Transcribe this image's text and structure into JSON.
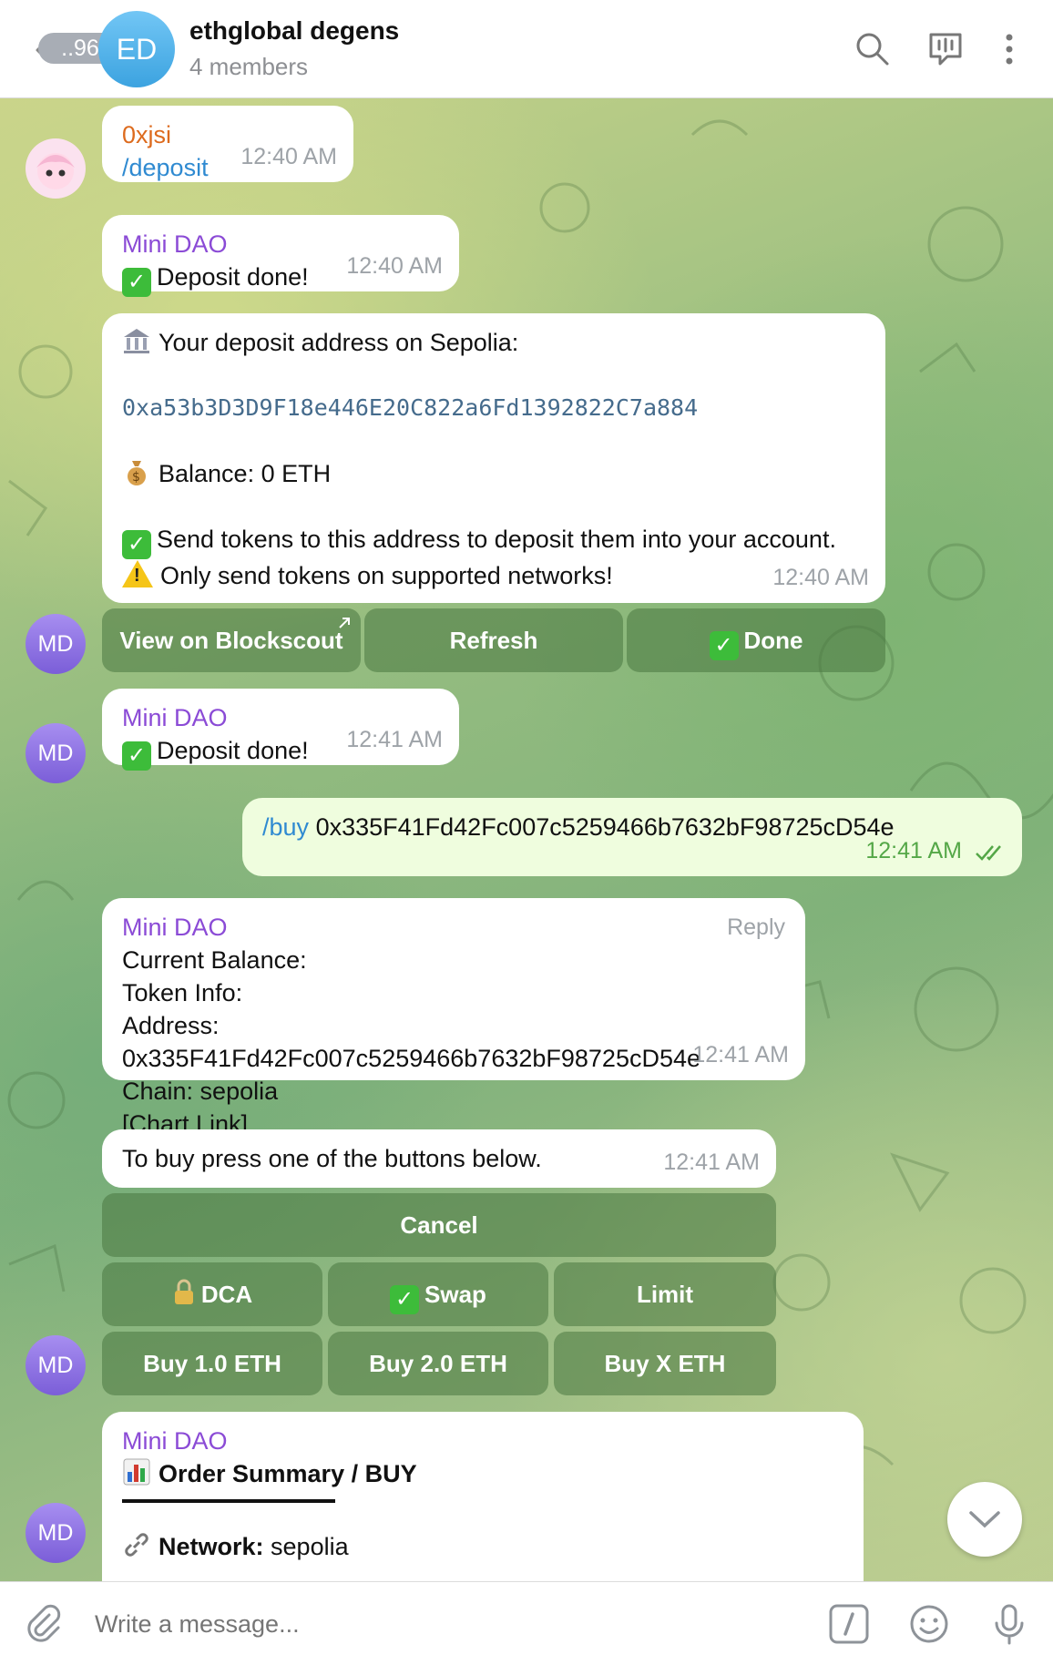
{
  "header": {
    "unread_count": "..96",
    "avatar_initials": "ED",
    "title": "ethglobal degens",
    "subtitle": "4 members"
  },
  "messages": {
    "m1": {
      "sender": "0xjsi",
      "command": "/deposit",
      "time": "12:40 AM"
    },
    "m2": {
      "sender": "Mini DAO",
      "text": "Deposit done!",
      "time": "12:40 AM"
    },
    "m3": {
      "line1": "Your deposit address on Sepolia:",
      "address": "0xa53b3D3D9F18e446E20C822a6Fd1392822C7a884",
      "balance": "Balance: 0 ETH",
      "send": "Send tokens to this address to deposit them into your account.",
      "warn": "Only send tokens on supported networks!",
      "time": "12:40 AM",
      "buttons": {
        "view": "View on Blockscout",
        "refresh": "Refresh",
        "done": "Done"
      }
    },
    "m4": {
      "sender": "Mini DAO",
      "text": "Deposit done!",
      "time": "12:41 AM"
    },
    "m5": {
      "command": "/buy",
      "text": "0x335F41Fd42Fc007c5259466b7632bF98725cD54e",
      "time": "12:41 AM"
    },
    "m6": {
      "sender": "Mini DAO",
      "reply": "Reply",
      "lines": [
        "Current Balance:",
        "Token Info:",
        "Address: 0x335F41Fd42Fc007c5259466b7632bF98725cD54e",
        "Chain: sepolia",
        "[Chart Link]"
      ],
      "time": "12:41 AM"
    },
    "m7": {
      "text": "To buy press one of the buttons below.",
      "time": "12:41 AM",
      "buttons": {
        "cancel": "Cancel",
        "dca": "DCA",
        "swap": "Swap",
        "limit": "Limit",
        "buy1": "Buy 1.0 ETH",
        "buy2": "Buy 2.0 ETH",
        "buyx": "Buy X ETH"
      }
    },
    "m8": {
      "sender": "Mini DAO",
      "title": "Order Summary / BUY",
      "network_label": "Network:",
      "network_value": "sepolia"
    }
  },
  "avatars": {
    "bot_initials": "MD"
  },
  "composer": {
    "placeholder": "Write a message..."
  },
  "colors": {
    "accent": "#2f8ad1",
    "bot_name": "#8b4bd6",
    "user_name": "#dd6b1e",
    "outgoing_bubble": "#effdde"
  }
}
